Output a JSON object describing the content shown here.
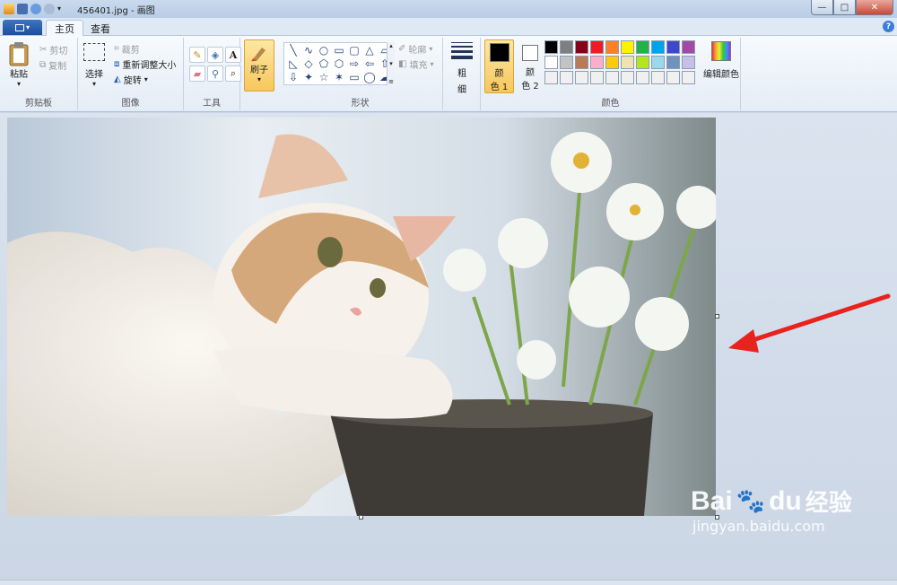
{
  "window": {
    "title": "456401.jpg - 画图",
    "minimize": "—",
    "maximize": "□",
    "close": "✕"
  },
  "tabs": {
    "home": "主页",
    "view": "查看",
    "help": "?"
  },
  "clipboard": {
    "group": "剪贴板",
    "paste": "粘贴",
    "cut": "剪切",
    "copy": "复制"
  },
  "image": {
    "group": "图像",
    "select": "选择",
    "crop": "裁剪",
    "resize": "重新调整大小",
    "rotate": "旋转"
  },
  "tools": {
    "group": "工具",
    "text_tool": "A"
  },
  "brush": {
    "label": "刷子"
  },
  "shapes": {
    "group": "形状",
    "items": [
      "╲",
      "∿",
      "○",
      "▭",
      "▢",
      "△",
      "▱",
      "◺",
      "◇",
      "⬠",
      "⬡",
      "⇨",
      "⇦",
      "⇧",
      "⇩",
      "✦",
      "☆",
      "✶",
      "▭",
      "◯",
      "☁"
    ],
    "outline": "轮廓",
    "fill": "填充"
  },
  "size": {
    "label1": "粗",
    "label2": "细"
  },
  "colors": {
    "group": "颜色",
    "color1_label1": "颜",
    "color1_label2": "色 1",
    "color2_label1": "颜",
    "color2_label2": "色 2",
    "edit": "编辑颜色",
    "color1": "#000000",
    "color2": "#ffffff",
    "palette": [
      "#000000",
      "#7f7f7f",
      "#880015",
      "#ed1c24",
      "#ff7f27",
      "#fff200",
      "#22b14c",
      "#00a2e8",
      "#3f48cc",
      "#a349a4",
      "#ffffff",
      "#c3c3c3",
      "#b97a57",
      "#ffaec9",
      "#ffc90e",
      "#efe4b0",
      "#b5e61d",
      "#99d9ea",
      "#7092be",
      "#c8bfe7",
      "#f0f0f0",
      "#f0f0f0",
      "#f0f0f0",
      "#f0f0f0",
      "#f0f0f0",
      "#f0f0f0",
      "#f0f0f0",
      "#f0f0f0",
      "#f0f0f0",
      "#f0f0f0"
    ]
  },
  "watermark": {
    "brand": "Bai",
    "du": "du",
    "sub": "经验",
    "url": "jingyan.baidu.com"
  },
  "arrow_color": "#e8221c"
}
